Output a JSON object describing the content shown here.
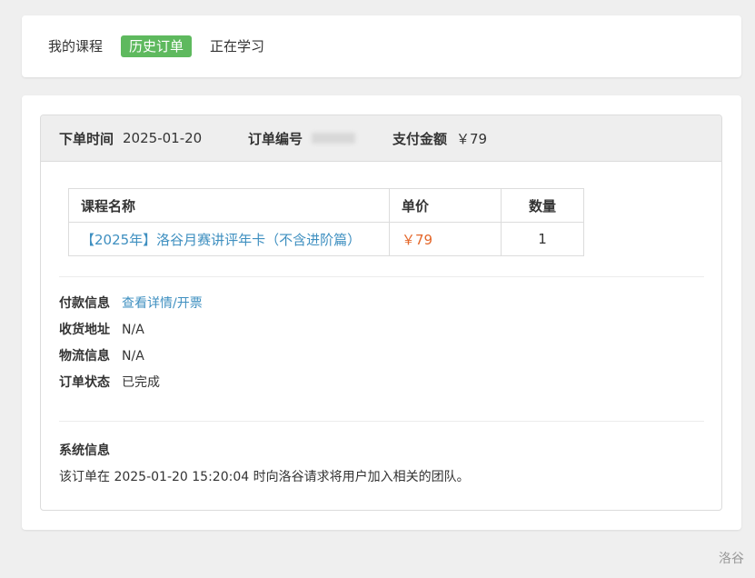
{
  "tabs": [
    {
      "label": "我的课程",
      "active": false
    },
    {
      "label": "历史订单",
      "active": true
    },
    {
      "label": "正在学习",
      "active": false
    }
  ],
  "order": {
    "time_label": "下单时间",
    "time_value": "2025-01-20",
    "number_label": "订单编号",
    "amount_label": "支付金额",
    "amount_value": "￥79",
    "table": {
      "headers": [
        "课程名称",
        "单价",
        "数量"
      ],
      "rows": [
        {
          "name": "【2025年】洛谷月赛讲评年卡（不含进阶篇）",
          "price": "￥79",
          "qty": "1"
        }
      ]
    },
    "info": {
      "payment_label": "付款信息",
      "payment_link": "查看详情/开票",
      "address_label": "收货地址",
      "address_value": "N/A",
      "logistics_label": "物流信息",
      "logistics_value": "N/A",
      "status_label": "订单状态",
      "status_value": "已完成"
    },
    "system": {
      "title": "系统信息",
      "text": "该订单在 2025-01-20 15:20:04 时向洛谷请求将用户加入相关的团队。"
    }
  },
  "footer": {
    "text": "洛谷"
  },
  "colors": {
    "accent_green": "#5eb95e",
    "price_orange": "#e4672a",
    "link_blue": "#3e8fc0",
    "background": "#efefef"
  }
}
